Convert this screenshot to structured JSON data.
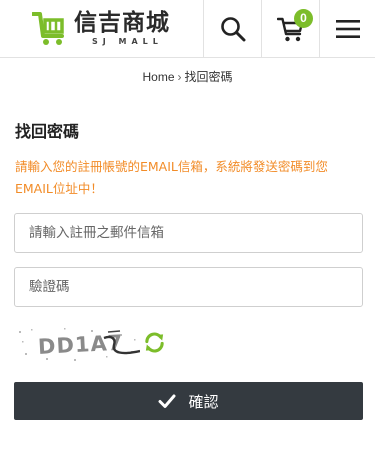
{
  "header": {
    "logo_title": "信吉商城",
    "logo_subtitle": "SJ MALL",
    "cart_count": "0",
    "brand_color": "#7cbd2a",
    "icons": [
      "logo-cart-icon",
      "search-icon",
      "cart-icon",
      "hamburger-menu-icon"
    ]
  },
  "breadcrumb": {
    "home": "Home",
    "separator": "›",
    "current": "找回密碼"
  },
  "form": {
    "title": "找回密碼",
    "notice": "請輸入您的註冊帳號的EMAIL信箱，系統將發送密碼到您EMAIL位址中！",
    "notice_color": "#f28c28",
    "email_placeholder": "請輸入註冊之郵件信箱",
    "email_value": "",
    "captcha_placeholder": "驗證碼",
    "captcha_value": "",
    "captcha_image_text": "DD1A7",
    "refresh_icon": "refresh-icon",
    "submit_label": "確認",
    "submit_icon": "check-icon",
    "submit_color": "#343a40"
  }
}
